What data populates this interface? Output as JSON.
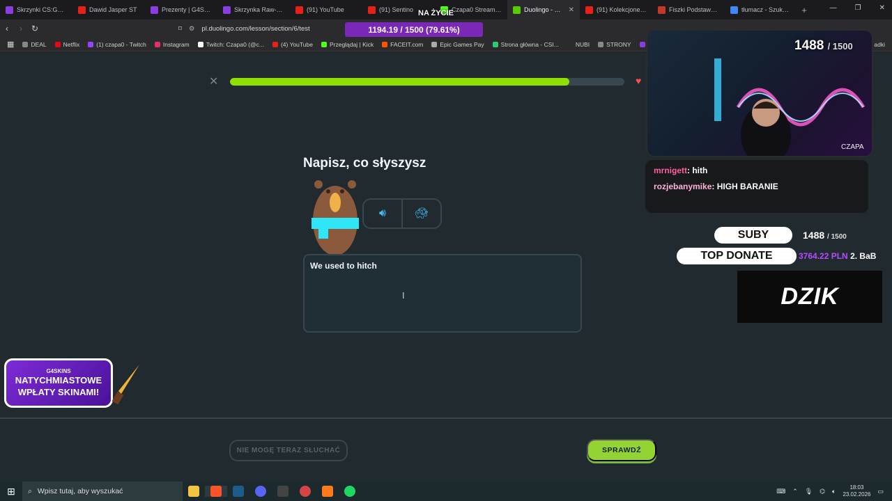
{
  "browser": {
    "tabs": [
      {
        "title": "Skrzynki CS:GO/CS2",
        "color": "#8a3ee0",
        "active": false
      },
      {
        "title": "Dawid Jasper ST",
        "color": "#e62117",
        "active": false
      },
      {
        "title": "Prezenty | G4Skins",
        "color": "#8a3ee0",
        "active": false
      },
      {
        "title": "Skrzynka Raw-Grow",
        "color": "#8a3ee0",
        "active": false
      },
      {
        "title": "(91) YouTube",
        "color": "#e62117",
        "active": false
      },
      {
        "title": "(91) Sentino",
        "color": "#e62117",
        "active": false
      },
      {
        "title": "Czapa0 Stream - W",
        "color": "#53fc18",
        "active": false
      },
      {
        "title": "Duolingo - Ucz",
        "color": "#58cc02",
        "active": true
      },
      {
        "title": "(91) Kolekcjoner śm",
        "color": "#e62117",
        "active": false
      },
      {
        "title": "Fiszki Podstawy Kol",
        "color": "#c0392b",
        "active": false
      },
      {
        "title": "tłumacz - Szukaj w",
        "color": "#4285f4",
        "active": false
      }
    ],
    "new_tab": "+",
    "url": "pl.duolingo.com/lesson/section/6/test",
    "bookmarks": [
      {
        "label": "DEAL",
        "color": "#888"
      },
      {
        "label": "Netflix",
        "color": "#e50914"
      },
      {
        "label": "(1) czapa0 - Twitch",
        "color": "#9146ff"
      },
      {
        "label": "Instagram",
        "color": "#e1306c"
      },
      {
        "label": "Twitch: Czapa0 (@c...",
        "color": "#ffffff"
      },
      {
        "label": "(4) YouTube",
        "color": "#e62117"
      },
      {
        "label": "Przeglądaj | Kick",
        "color": "#53fc18"
      },
      {
        "label": "FACEIT.com",
        "color": "#ff5500"
      },
      {
        "label": "Epic Games Pay",
        "color": "#aaaaaa"
      },
      {
        "label": "Strona główna - CSI...",
        "color": "#2ecc71"
      },
      {
        "label": "NUBI",
        "color": "#2b2b2e"
      },
      {
        "label": "STRONY",
        "color": "#888"
      },
      {
        "label": "Skrzy",
        "color": "#8a3ee0"
      }
    ],
    "bookmarks_overflow": "adki"
  },
  "lesson": {
    "progress_percent": 86,
    "instruction": "Napisz, co słyszysz",
    "answer_text": "We used to hitch",
    "skip_label": "NIE MOGĘ TERAZ SŁUCHAĆ",
    "check_label": "SPRAWDŹ"
  },
  "overlay": {
    "goal_bar": "1194.19 / 1500 (79.61%)",
    "na_zycie": "NA ŻYCIE",
    "cam_count": "1488",
    "cam_goal": "/ 1500",
    "cam_label": "CZAPA",
    "chat": [
      {
        "user": "mrnigett",
        "message": "hith"
      },
      {
        "user": "rozjebanymike",
        "message": "HIGH BARANIE"
      }
    ],
    "suby_label": "SUBY",
    "suby_value": "1488",
    "suby_goal": "/ 1500",
    "top_donate_label": "TOP DONATE",
    "top_donate_value": "3764.22 PLN",
    "top_donate_name": "2. BaB",
    "logo_text": "DZIK",
    "promo_brand": "G4SKINS",
    "promo_line1": "NATYCHMIASTOWE",
    "promo_line2": "WPŁATY SKINAMI!"
  },
  "taskbar": {
    "search_placeholder": "Wpisz tutaj, aby wyszukać",
    "time": "18:03",
    "date": "23.02.2026"
  }
}
